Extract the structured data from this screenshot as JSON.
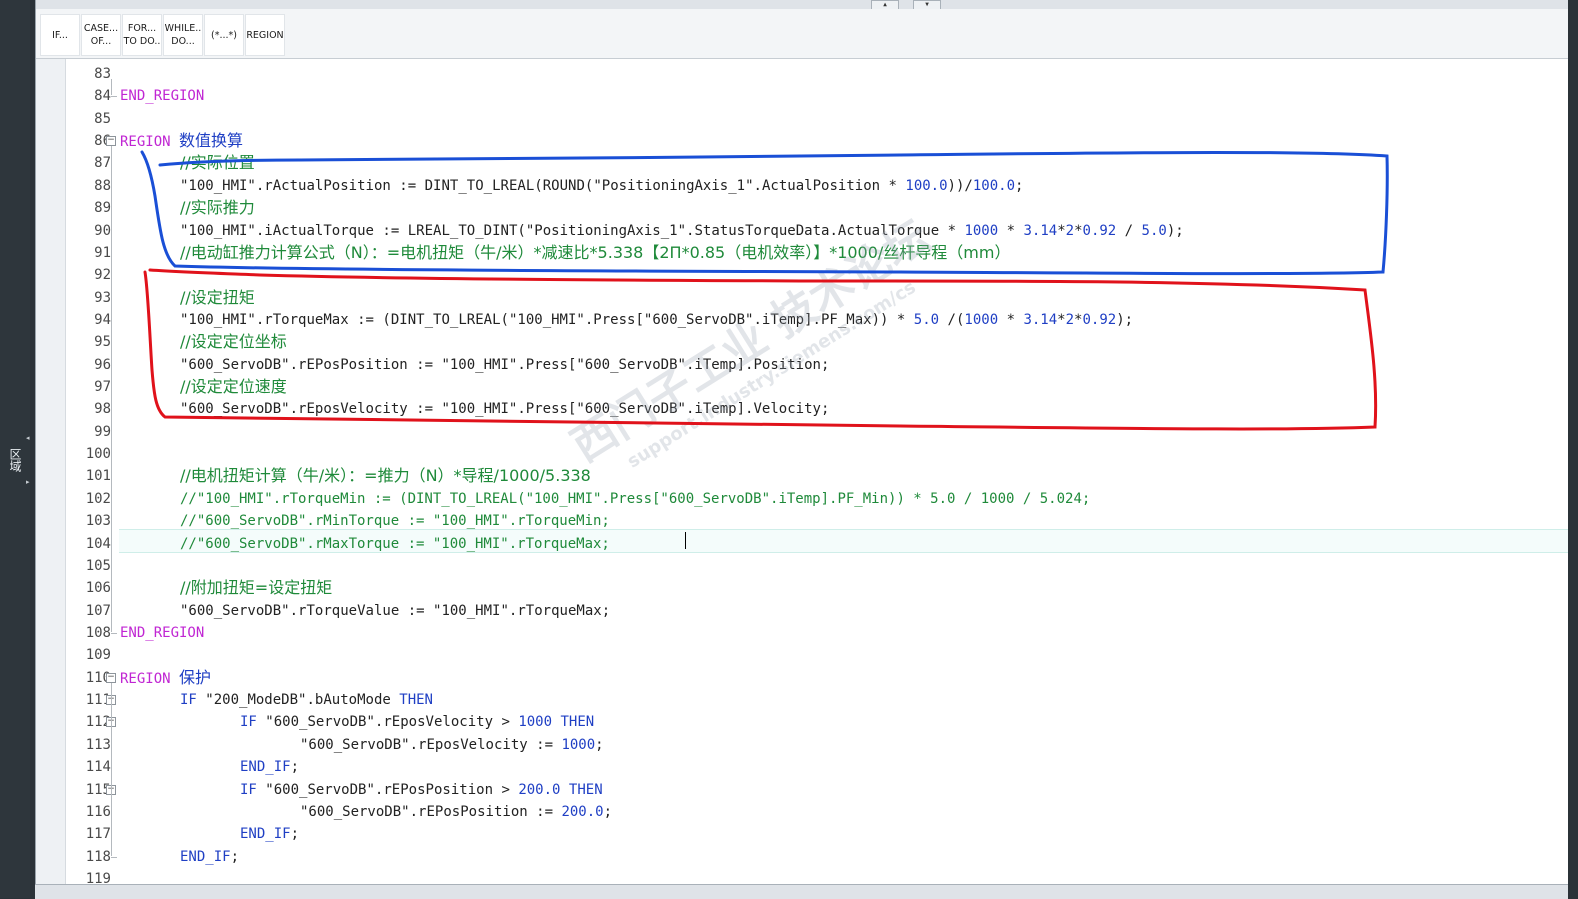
{
  "side_panel": {
    "tab_label": "区域"
  },
  "toolbar": {
    "buttons": [
      {
        "line1": "IF...",
        "line2": ""
      },
      {
        "line1": "CASE...",
        "line2": "OF..."
      },
      {
        "line1": "FOR...",
        "line2": "TO DO.."
      },
      {
        "line1": "WHILE..",
        "line2": "DO..."
      },
      {
        "line1": "(*...*)",
        "line2": ""
      },
      {
        "line1": "REGION",
        "line2": ""
      }
    ]
  },
  "annotation_colors": {
    "blue_box": "#1a4fd6",
    "red_box": "#e0121b"
  },
  "lines": [
    {
      "n": "83",
      "text": ""
    },
    {
      "n": "84",
      "text": "END_REGION"
    },
    {
      "n": "85",
      "text": ""
    },
    {
      "n": "86",
      "text": "REGION 数值换算"
    },
    {
      "n": "87",
      "text": "//实际位置"
    },
    {
      "n": "88",
      "text": "\"100_HMI\".rActualPosition := DINT_TO_LREAL(ROUND(\"PositioningAxis_1\".ActualPosition * 100.0))/100.0;"
    },
    {
      "n": "89",
      "text": "//实际推力"
    },
    {
      "n": "90",
      "text": "\"100_HMI\".iActualTorque := LREAL_TO_DINT(\"PositioningAxis_1\".StatusTorqueData.ActualTorque * 1000 * 3.14*2*0.92 / 5.0);"
    },
    {
      "n": "91",
      "text": "//电动缸推力计算公式（N）：=电机扭矩（牛/米）*减速比*5.338【2Π*0.85（电机效率）】*1000/丝杆导程（mm）"
    },
    {
      "n": "92",
      "text": ""
    },
    {
      "n": "93",
      "text": "//设定扭矩"
    },
    {
      "n": "94",
      "text": "\"100_HMI\".rTorqueMax := (DINT_TO_LREAL(\"100_HMI\".Press[\"600_ServoDB\".iTemp].PF_Max)) * 5.0 /(1000 * 3.14*2*0.92);"
    },
    {
      "n": "95",
      "text": "//设定定位坐标"
    },
    {
      "n": "96",
      "text": "\"600_ServoDB\".rEPosPosition := \"100_HMI\".Press[\"600_ServoDB\".iTemp].Position;"
    },
    {
      "n": "97",
      "text": "//设定定位速度"
    },
    {
      "n": "98",
      "text": "\"600_ServoDB\".rEposVelocity := \"100_HMI\".Press[\"600_ServoDB\".iTemp].Velocity;"
    },
    {
      "n": "99",
      "text": ""
    },
    {
      "n": "100",
      "text": ""
    },
    {
      "n": "101",
      "text": "//电机扭矩计算（牛/米）：=推力（N）*导程/1000/5.338"
    },
    {
      "n": "102",
      "text": "//\"100_HMI\".rTorqueMin := (DINT_TO_LREAL(\"100_HMI\".Press[\"600_ServoDB\".iTemp].PF_Min)) * 5.0 / 1000 / 5.024;"
    },
    {
      "n": "103",
      "text": "//\"600_ServoDB\".rMinTorque := \"100_HMI\".rTorqueMin;"
    },
    {
      "n": "104",
      "text": "//\"600_ServoDB\".rMaxTorque := \"100_HMI\".rTorqueMax;"
    },
    {
      "n": "105",
      "text": ""
    },
    {
      "n": "106",
      "text": "//附加扭矩=设定扭矩"
    },
    {
      "n": "107",
      "text": "\"600_ServoDB\".rTorqueValue := \"100_HMI\".rTorqueMax;"
    },
    {
      "n": "108",
      "text": "END_REGION"
    },
    {
      "n": "109",
      "text": ""
    },
    {
      "n": "110",
      "text": "REGION 保护"
    },
    {
      "n": "111",
      "text": "IF \"200_ModeDB\".bAutoMode THEN"
    },
    {
      "n": "112",
      "text": "IF \"600_ServoDB\".rEposVelocity > 1000 THEN"
    },
    {
      "n": "113",
      "text": "\"600_ServoDB\".rEposVelocity := 1000;"
    },
    {
      "n": "114",
      "text": "END_IF;"
    },
    {
      "n": "115",
      "text": "IF \"600_ServoDB\".rEPosPosition > 200.0 THEN"
    },
    {
      "n": "116",
      "text": "\"600_ServoDB\".rEPosPosition := 200.0;"
    },
    {
      "n": "117",
      "text": "END_IF;"
    },
    {
      "n": "118",
      "text": "END_IF;"
    },
    {
      "n": "119",
      "text": ""
    }
  ],
  "watermark": {
    "main": "西门子工业 技术论坛",
    "sub": "support.industry.siemens.com/cs"
  }
}
